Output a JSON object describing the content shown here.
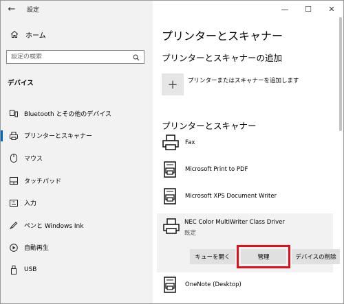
{
  "app": {
    "title": "設定"
  },
  "window_controls": {
    "minimize": "—",
    "maximize": "☐",
    "close": "✕"
  },
  "sidebar": {
    "home_label": "ホーム",
    "search_placeholder": "設定の検索",
    "section_title": "デバイス",
    "items": [
      {
        "label": "Bluetooth とその他のデバイス",
        "icon": "bluetooth-devices-icon"
      },
      {
        "label": "プリンターとスキャナー",
        "icon": "printer-icon",
        "active": true
      },
      {
        "label": "マウス",
        "icon": "mouse-icon"
      },
      {
        "label": "タッチパッド",
        "icon": "touchpad-icon"
      },
      {
        "label": "入力",
        "icon": "keyboard-icon"
      },
      {
        "label": "ペンと Windows Ink",
        "icon": "pen-icon"
      },
      {
        "label": "自動再生",
        "icon": "autoplay-icon"
      },
      {
        "label": "USB",
        "icon": "usb-icon"
      }
    ]
  },
  "main": {
    "page_title": "プリンターとスキャナー",
    "add_section_title": "プリンターとスキャナーの追加",
    "add_label": "プリンターまたはスキャナーを追加します",
    "list_section_title": "プリンターとスキャナー",
    "devices": [
      {
        "name": "Fax",
        "icon": "fax-printer-icon"
      },
      {
        "name": "Microsoft Print to PDF",
        "icon": "document-printer-icon"
      },
      {
        "name": "Microsoft XPS Document Writer",
        "icon": "document-printer-icon"
      }
    ],
    "selected_device": {
      "name": "NEC Color MultiWriter Class Driver",
      "status": "既定",
      "buttons": {
        "queue": "キューを開く",
        "manage": "管理",
        "remove": "デバイスの削除"
      }
    },
    "last_device": {
      "name": "OneNote (Desktop)"
    }
  },
  "colors": {
    "accent": "#0067c0",
    "highlight_box": "#e0101a",
    "sidebar_bg": "#f2f2f2"
  }
}
